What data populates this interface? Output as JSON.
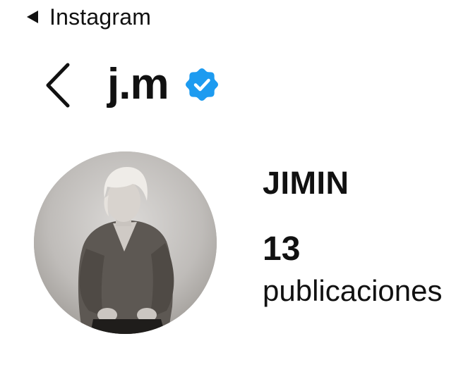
{
  "status_bar": {
    "back_app_label": "Instagram",
    "back_icon": "back-triangle-icon"
  },
  "header": {
    "back_icon": "chevron-left-icon",
    "username": "j.m",
    "verified_icon": "verified-badge-icon",
    "verified_color": "#1d9bf0"
  },
  "profile": {
    "avatar_icon": "profile-photo",
    "display_name": "JIMIN",
    "posts_count": "13",
    "posts_label": "publicaciones"
  }
}
